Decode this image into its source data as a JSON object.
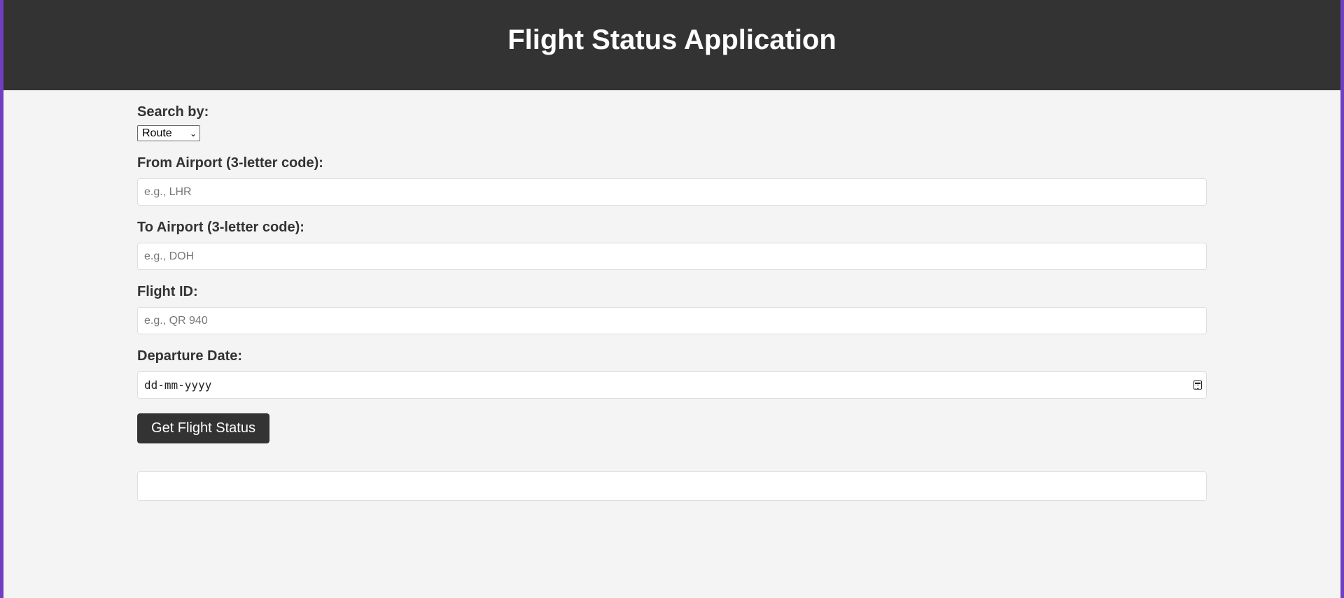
{
  "header": {
    "title": "Flight Status Application"
  },
  "form": {
    "search_by": {
      "label": "Search by:",
      "selected": "Route"
    },
    "from_airport": {
      "label": "From Airport (3-letter code):",
      "placeholder": "e.g., LHR",
      "value": ""
    },
    "to_airport": {
      "label": "To Airport (3-letter code):",
      "placeholder": "e.g., DOH",
      "value": ""
    },
    "flight_id": {
      "label": "Flight ID:",
      "placeholder": "e.g., QR 940",
      "value": ""
    },
    "departure_date": {
      "label": "Departure Date:",
      "placeholder": "dd-mm-yyyy",
      "icon": "calendar-icon"
    },
    "submit_label": "Get Flight Status"
  },
  "result": {
    "text": ""
  },
  "colors": {
    "header_bg": "#333333",
    "page_bg": "#f4f4f4",
    "frame_accent": "#6f3fbf",
    "button_bg": "#333333"
  }
}
